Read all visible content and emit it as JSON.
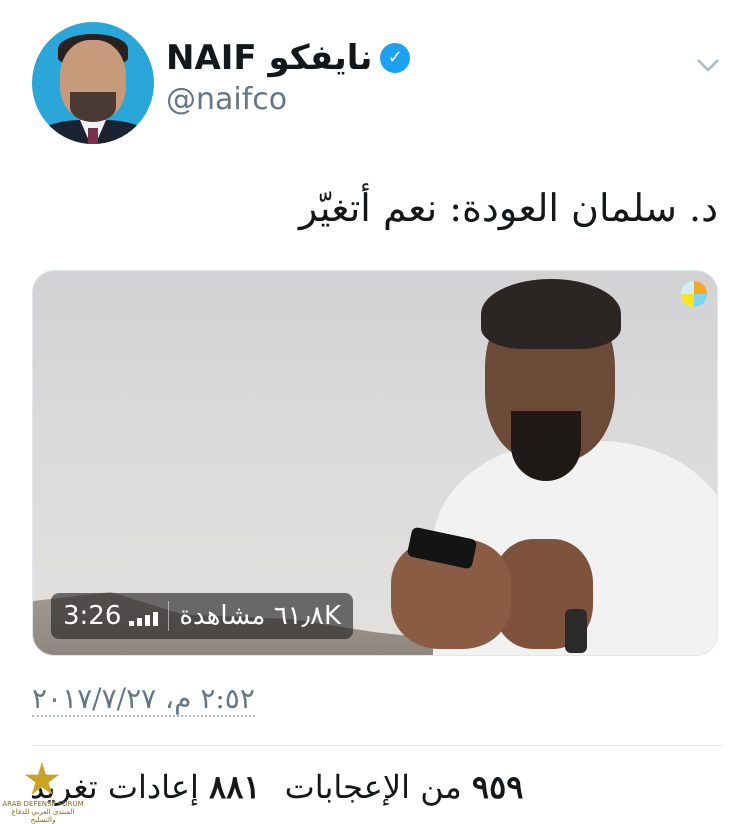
{
  "profile": {
    "display_name": "NAIF نايفكو",
    "handle": "@naifco",
    "verified": true,
    "avatar_icon": "avatar-photo"
  },
  "header": {
    "menu_icon": "chevron-down-icon"
  },
  "tweet": {
    "text": "د. سلمان العودة: نعم أتغيّر",
    "timestamp": "٢:٥٢ م، ٢٠١٧/٧/٢٧"
  },
  "media": {
    "duration": "3:26",
    "views": "٦١٫٨K مشاهدة"
  },
  "stats": {
    "retweets_count": "٨٨١",
    "retweets_label": "إعادات تغريد",
    "likes_count": "٩٥٩",
    "likes_label": "من الإعجابات"
  },
  "watermark": {
    "line1": "ARAB DEFENSE FORUM",
    "line2": "المنتدى العربي للدفاع والتسليح"
  },
  "colors": {
    "verified": "#1da1f2",
    "secondary_text": "#657786",
    "avatar_bg": "#2aa7d8"
  }
}
